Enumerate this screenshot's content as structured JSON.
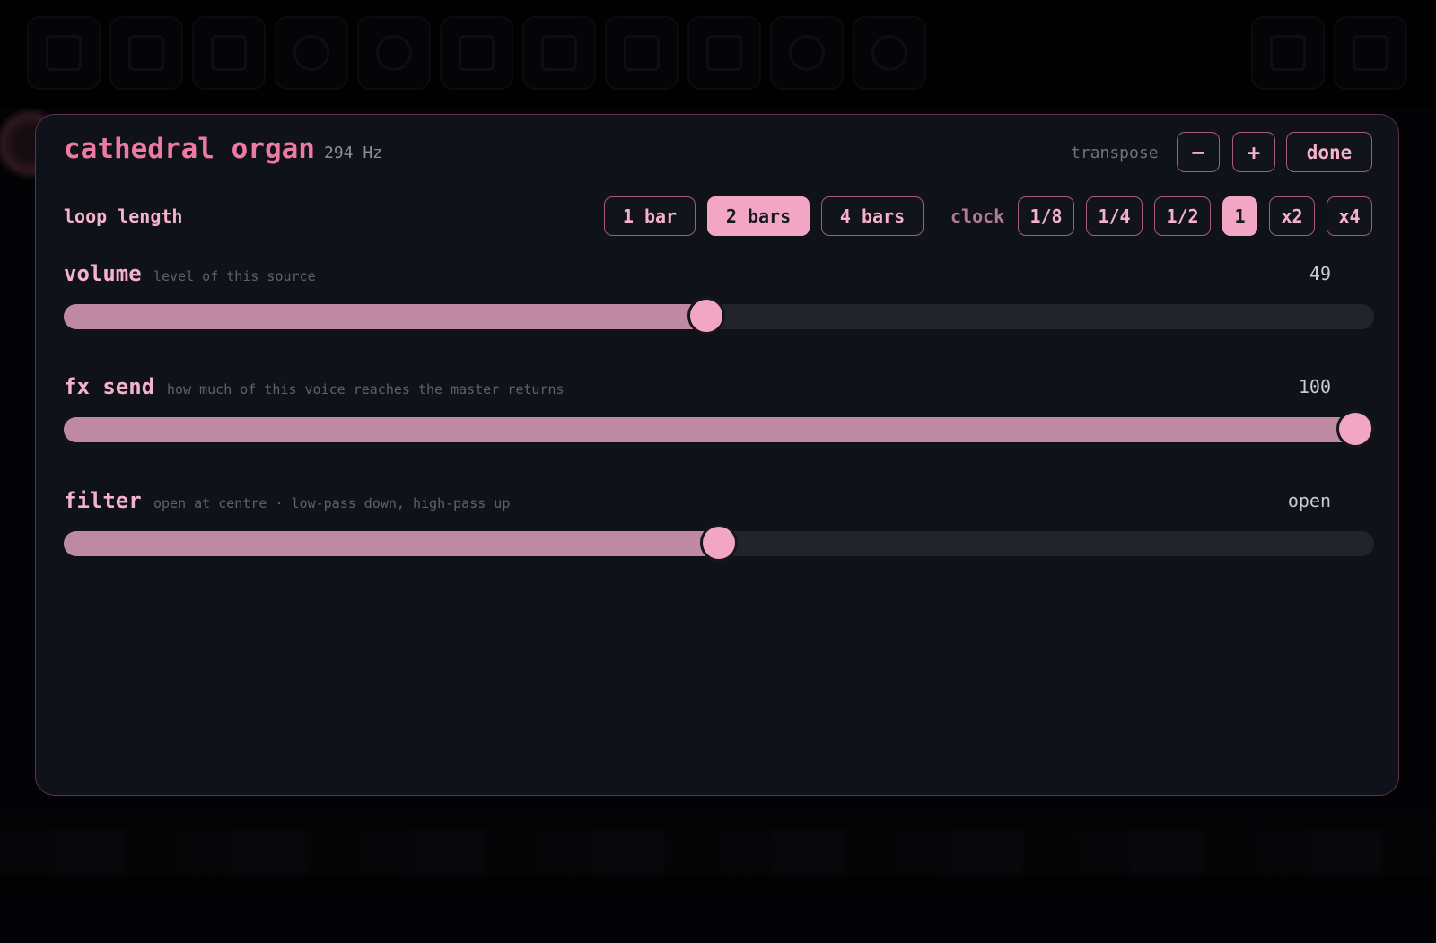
{
  "panel": {
    "title": "cathedral organ",
    "frequency": "294 Hz",
    "transpose_label": "transpose",
    "transpose_down": "−",
    "transpose_up": "+",
    "done_label": "done"
  },
  "loop": {
    "label": "loop length",
    "options": [
      "1 bar",
      "2 bars",
      "4 bars"
    ],
    "selected": "2 bars"
  },
  "clock": {
    "label": "clock",
    "options": [
      "1/8",
      "1/4",
      "1/2",
      "1",
      "x2",
      "x4"
    ],
    "selected": "1"
  },
  "sliders": {
    "volume": {
      "name": "volume",
      "description": "level of this source",
      "value_text": "49",
      "level": 0.49
    },
    "fx_send": {
      "name": "fx send",
      "description": "how much of this voice reaches the master returns",
      "value_text": "100",
      "level": 1.0
    },
    "filter": {
      "name": "filter",
      "description": "open at centre · low-pass down, high-pass up",
      "value_text": "open",
      "level": 0.5
    }
  },
  "colors": {
    "accent": "#f2a6c3",
    "title": "#ee7aa3",
    "panel_bg": "#10121a",
    "track": "#22242b",
    "fill": "#bf8aa1"
  }
}
